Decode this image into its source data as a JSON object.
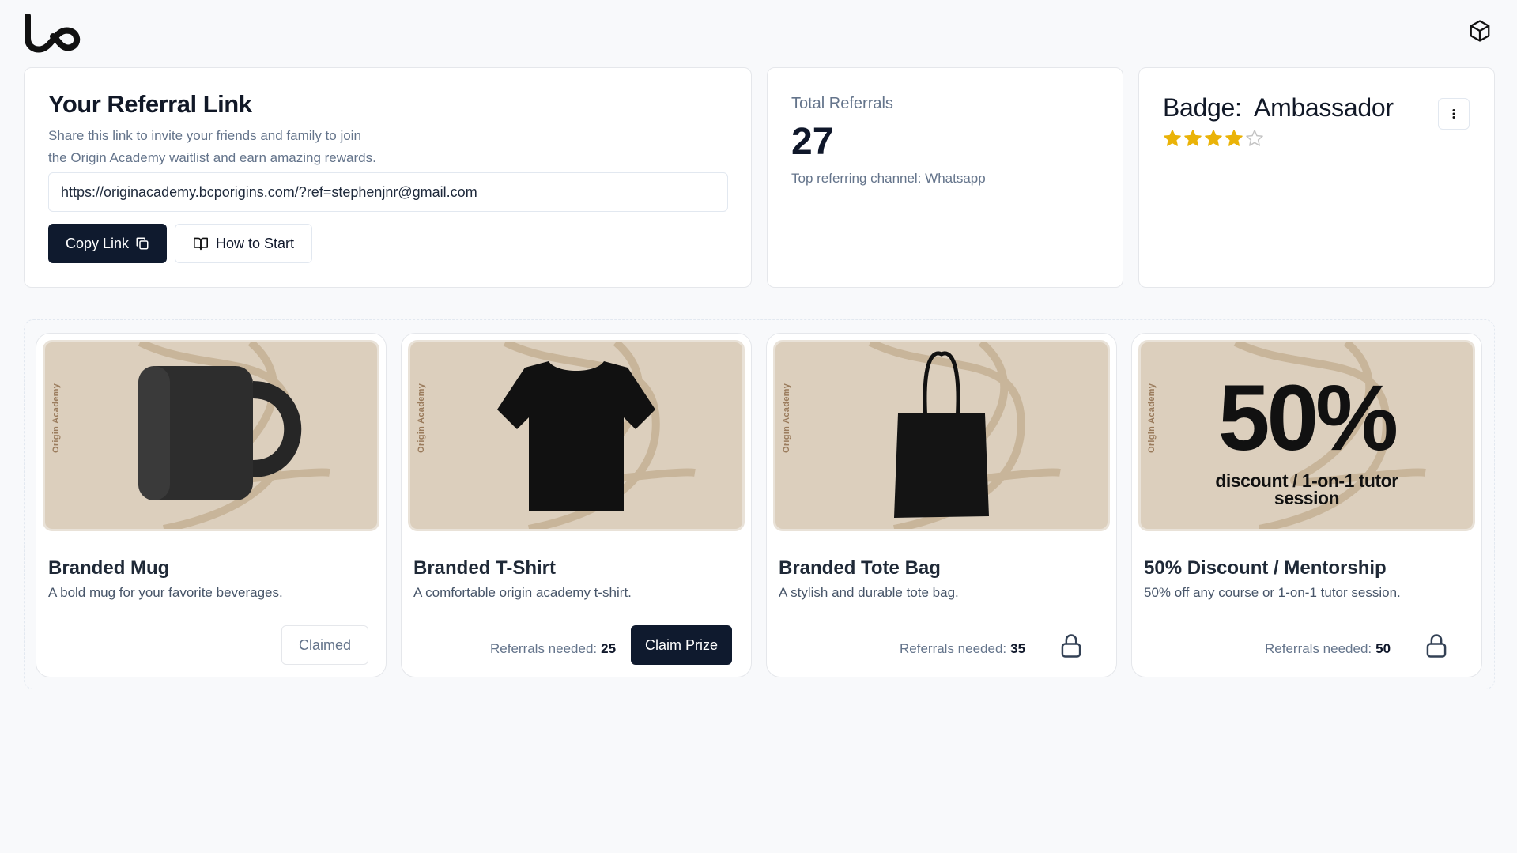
{
  "header": {
    "logo_icon": "brand-logo-icon",
    "right_icon": "cube-icon"
  },
  "referral": {
    "title": "Your Referral Link",
    "description_line1": "Share this link to invite your friends and family to join",
    "description_line2": "the Origin Academy waitlist and earn amazing rewards.",
    "link_value": "https://originacademy.bcporigins.com/?ref=stephenjnr@gmail.com",
    "copy_label": "Copy Link",
    "how_label": "How to Start"
  },
  "stats": {
    "total_label": "Total Referrals",
    "total_value": "27",
    "channel_text": "Top referring channel: Whatsapp"
  },
  "badge": {
    "title": "Badge:  Ambassador",
    "rating": 4,
    "rating_max": 5,
    "star_color": "#eab308"
  },
  "brand_vertical": "Origin Academy",
  "prizes": [
    {
      "title": "Branded Mug",
      "description": "A bold mug for your favorite beverages.",
      "status": "claimed",
      "button_label": "Claimed"
    },
    {
      "title": "Branded T-Shirt",
      "description": "A comfortable origin academy t-shirt.",
      "status": "claimable",
      "needed_label": "Referrals needed:",
      "needed_value": "25",
      "button_label": "Claim Prize"
    },
    {
      "title": "Branded Tote Bag",
      "description": "A stylish and durable tote bag.",
      "status": "locked",
      "needed_label": "Referrals needed:",
      "needed_value": "35"
    },
    {
      "title": "50% Discount / Mentorship",
      "description": "50% off any course or 1-on-1 tutor session.",
      "status": "locked",
      "needed_label": "Referrals needed:",
      "needed_value": "50",
      "image_big": "50%",
      "image_sub_line1": "discount / 1-on-1 tutor",
      "image_sub_line2": "session"
    }
  ]
}
